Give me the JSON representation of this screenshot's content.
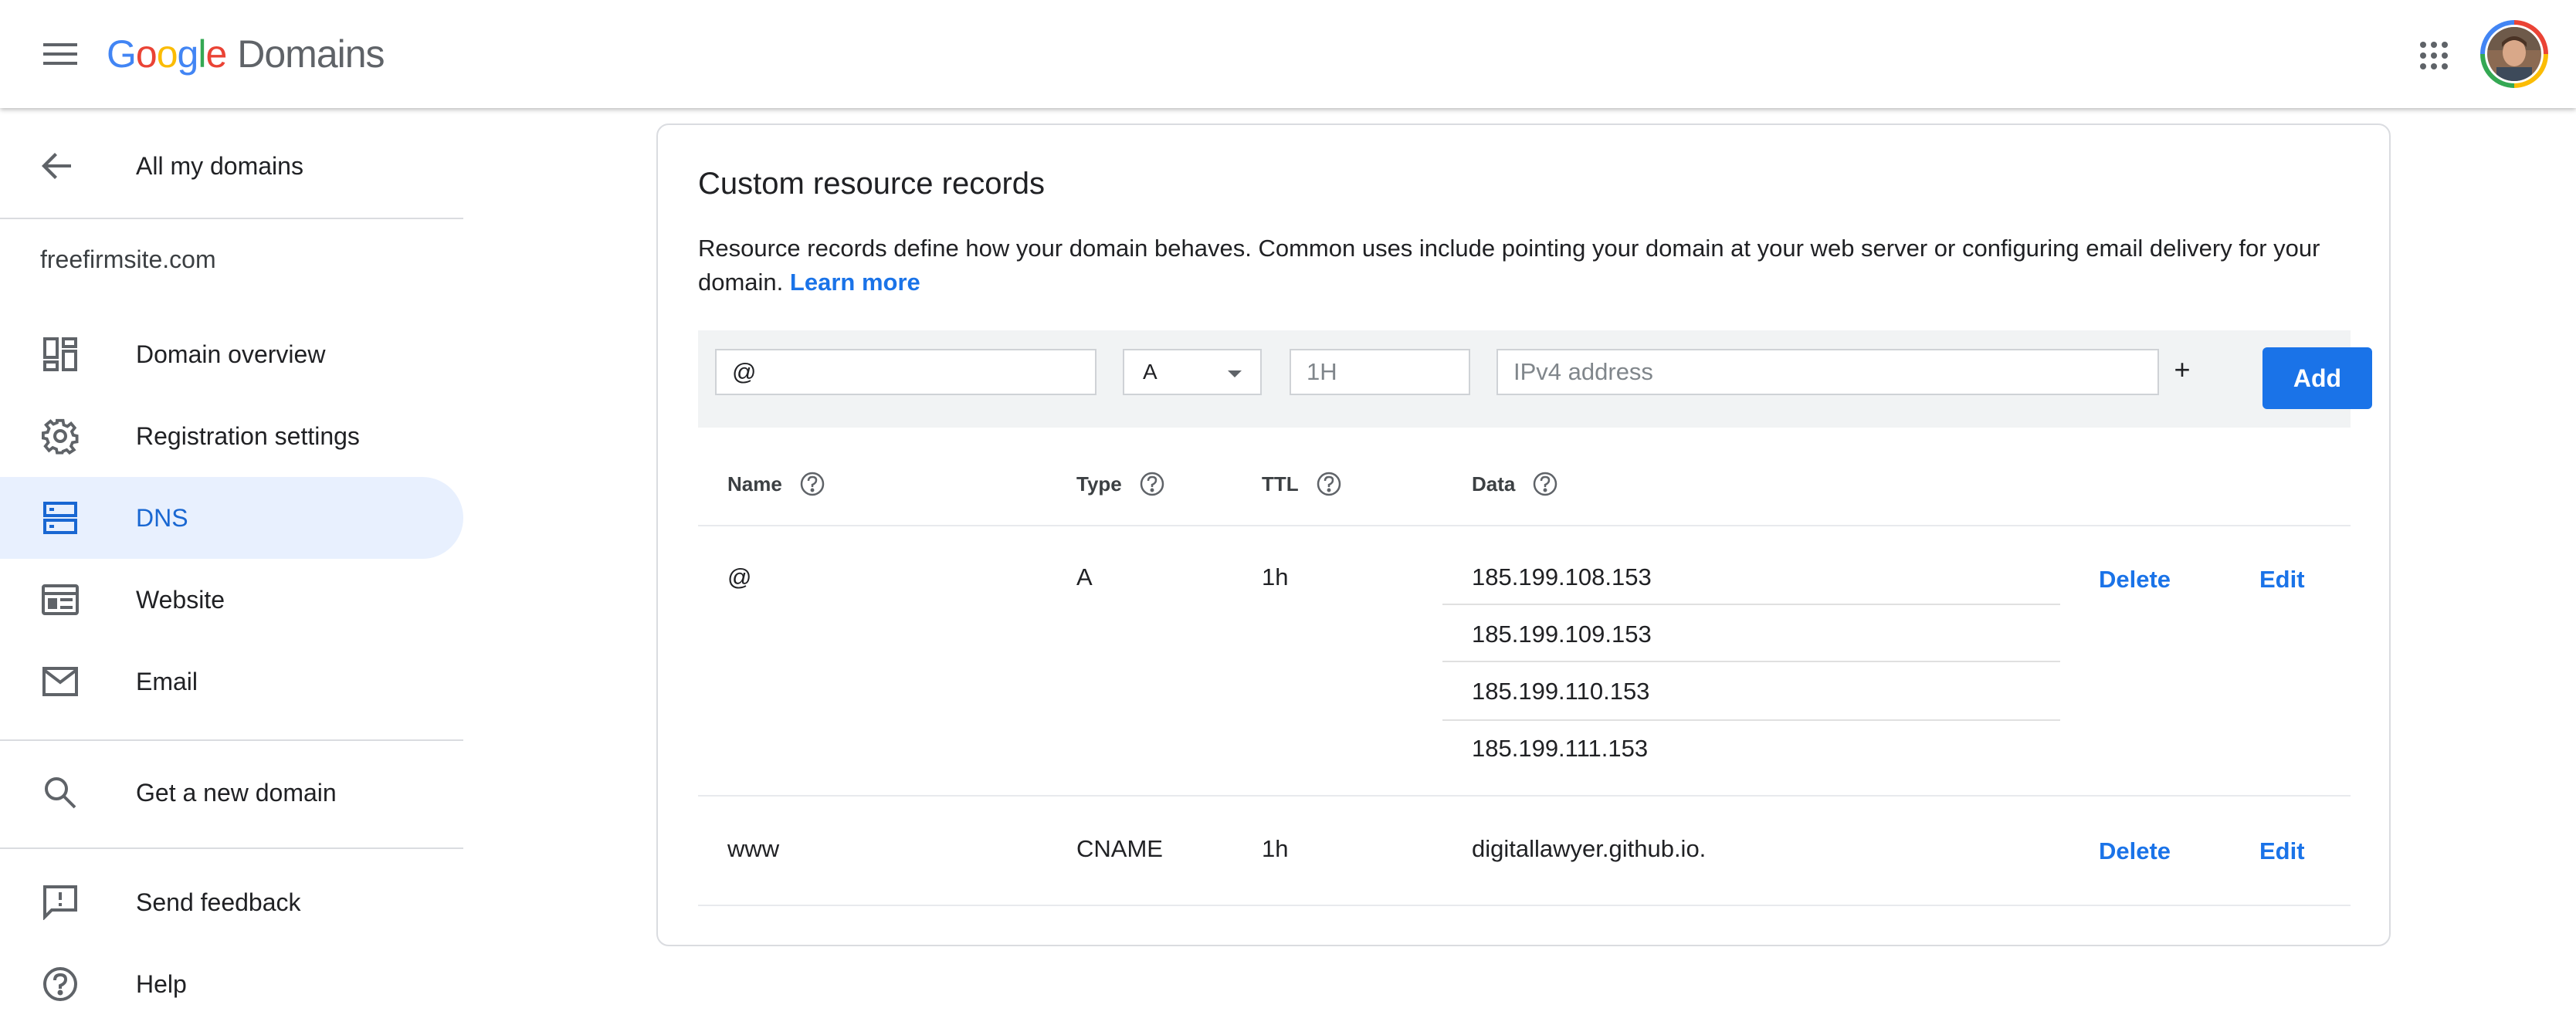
{
  "header": {
    "logo_google": [
      "G",
      "o",
      "o",
      "g",
      "l",
      "e"
    ],
    "product": "Domains"
  },
  "sidebar": {
    "back_label": "All my domains",
    "domain": "freefirmsite.com",
    "items": [
      {
        "label": "Domain overview",
        "icon": "dashboard-icon",
        "active": false
      },
      {
        "label": "Registration settings",
        "icon": "gear-icon",
        "active": false
      },
      {
        "label": "DNS",
        "icon": "dns-icon",
        "active": true
      },
      {
        "label": "Website",
        "icon": "website-icon",
        "active": false
      },
      {
        "label": "Email",
        "icon": "email-icon",
        "active": false
      }
    ],
    "get_domain_label": "Get a new domain",
    "feedback_label": "Send feedback",
    "help_label": "Help"
  },
  "records": {
    "title": "Custom resource records",
    "description": "Resource records define how your domain behaves. Common uses include pointing your domain at your web server or configuring email delivery for your domain.",
    "learn_more": "Learn more",
    "form": {
      "name_value": "@",
      "type_value": "A",
      "ttl_placeholder": "1H",
      "data_placeholder": "IPv4 address",
      "plus": "+",
      "add_label": "Add"
    },
    "columns": [
      "Name",
      "Type",
      "TTL",
      "Data"
    ],
    "rows": [
      {
        "name": "@",
        "type": "A",
        "ttl": "1h",
        "data": [
          "185.199.108.153",
          "185.199.109.153",
          "185.199.110.153",
          "185.199.111.153"
        ],
        "delete": "Delete",
        "edit": "Edit"
      },
      {
        "name": "www",
        "type": "CNAME",
        "ttl": "1h",
        "data": [
          "digitallawyer.github.io."
        ],
        "delete": "Delete",
        "edit": "Edit"
      }
    ]
  },
  "colors": {
    "accent": "#1a73e8",
    "active_bg": "#e8f0fe",
    "active_text": "#1967d2"
  }
}
